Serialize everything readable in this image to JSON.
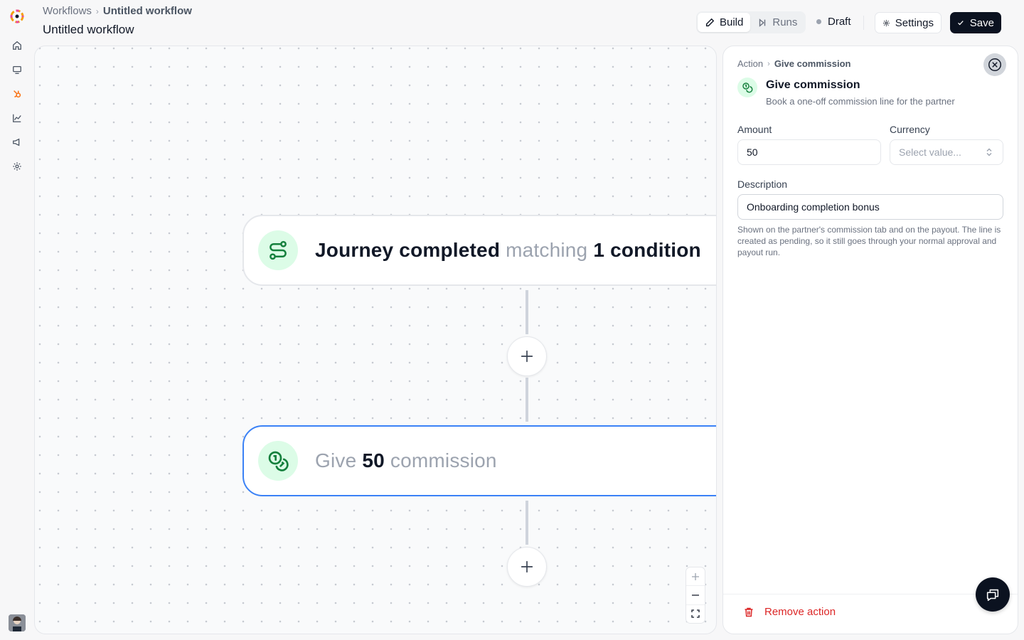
{
  "header": {
    "breadcrumb": [
      "Workflows",
      "Untitled workflow"
    ],
    "title": "Untitled workflow",
    "tabs": [
      {
        "label": "Build",
        "icon": "pencil-icon",
        "active": true
      },
      {
        "label": "Runs",
        "icon": "play-skip-icon",
        "active": false
      }
    ],
    "status": "Draft",
    "settings_label": "Settings",
    "save_label": "Save"
  },
  "sidebar": {
    "items": [
      "home-icon",
      "monitor-icon",
      "hubspot-icon",
      "chart-icon",
      "megaphone-icon",
      "gear-icon"
    ]
  },
  "canvas": {
    "trigger": {
      "icon": "route-icon",
      "parts": [
        {
          "text": "Journey completed",
          "style": "strong"
        },
        {
          "text": " matching ",
          "style": "muted"
        },
        {
          "text": "1 condition",
          "style": "strong"
        }
      ]
    },
    "action": {
      "icon": "coins-icon",
      "selected": true,
      "parts": [
        {
          "text": "Give ",
          "style": "muted"
        },
        {
          "text": "50",
          "style": "strong"
        },
        {
          "text": " commission",
          "style": "muted"
        }
      ]
    }
  },
  "panel": {
    "breadcrumb": [
      "Action",
      "Give commission"
    ],
    "title": "Give commission",
    "subtitle": "Book a one-off commission line for the partner",
    "amount": {
      "label": "Amount",
      "value": "50"
    },
    "currency": {
      "label": "Currency",
      "placeholder": "Select value..."
    },
    "description": {
      "label": "Description",
      "value": "Onboarding completion bonus",
      "help": "Shown on the partner's commission tab and on the payout. The line is created as pending, so it still goes through your normal approval and payout run."
    },
    "remove_label": "Remove action"
  },
  "colors": {
    "accent_dark": "#0b1220",
    "selected_border": "#3b82f6",
    "icon_bg": "#dcfce7",
    "icon_fg": "#15803d",
    "danger": "#dc2626"
  }
}
